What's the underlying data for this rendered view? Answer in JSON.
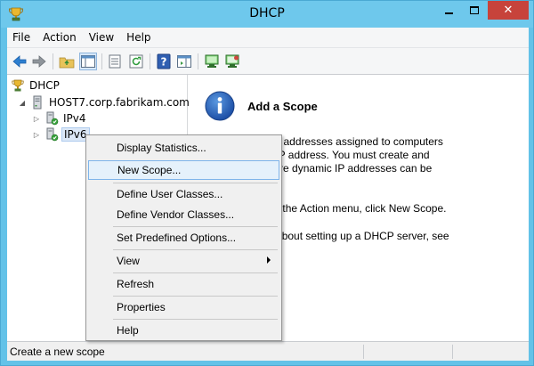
{
  "window": {
    "title": "DHCP",
    "minimize": "—",
    "close": "✕"
  },
  "menubar": {
    "items": [
      "File",
      "Action",
      "View",
      "Help"
    ]
  },
  "toolbar": {
    "buttons": [
      "back-icon",
      "forward-icon",
      "up-folder-icon",
      "show-hide-tree-icon",
      "export-list-icon",
      "refresh-icon",
      "help-icon",
      "action-pane-icon",
      "computer-active-icon",
      "computer-inactive-icon"
    ]
  },
  "tree": {
    "root": "DHCP",
    "server": "HOST7.corp.fabrikam.com",
    "ipv4": "IPv4",
    "ipv6": "IPv6"
  },
  "detail": {
    "title": "Add a Scope",
    "lines": [
      "ge of IP addresses assigned to computers",
      "namic IP address. You must create and",
      "pe before dynamic IP addresses can be",
      "ope, on the Action menu, click New Scope.",
      "nation about setting up a DHCP server, see"
    ]
  },
  "context_menu": {
    "items": [
      "Display Statistics...",
      "New Scope...",
      "Define User Classes...",
      "Define Vendor Classes...",
      "Set Predefined Options...",
      "View",
      "Refresh",
      "Properties",
      "Help"
    ],
    "highlighted": "New Scope..."
  },
  "statusbar": {
    "text": "Create a new scope"
  },
  "colors": {
    "title_bar": "#6ec8ec",
    "close_button": "#c7433b",
    "highlight": "#e5f1fb",
    "highlight_border": "#7eb4ea"
  }
}
